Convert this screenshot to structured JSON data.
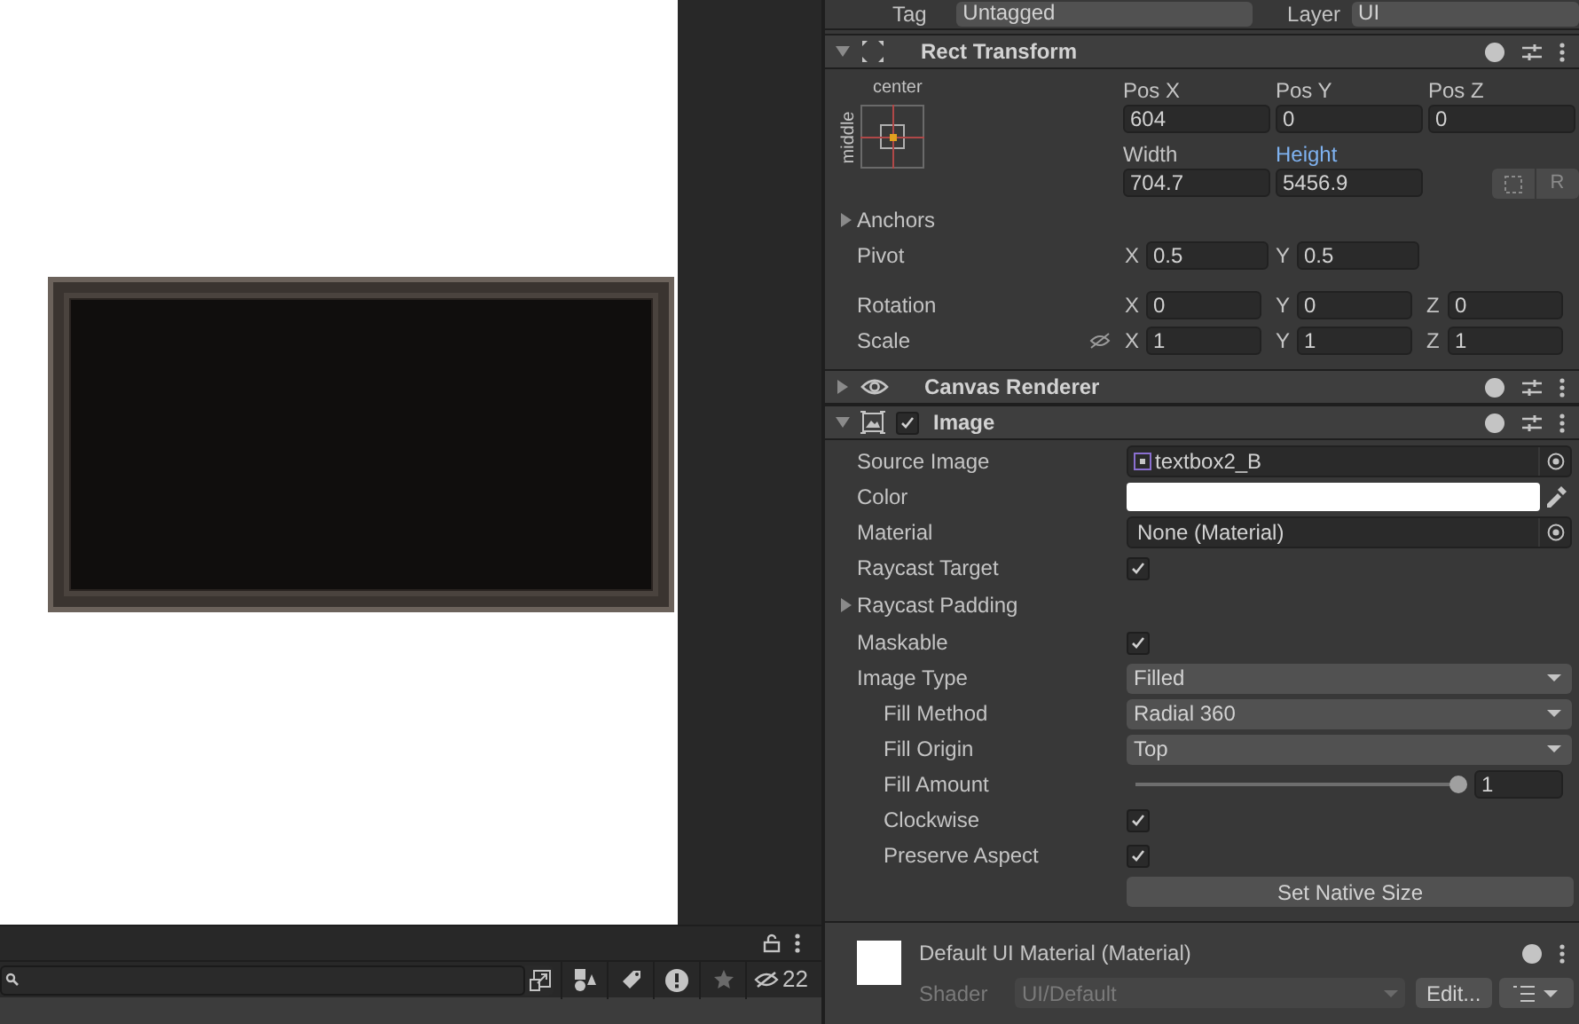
{
  "header_row": {
    "tag_label": "Tag",
    "tag_value": "Untagged",
    "layer_label": "Layer",
    "layer_value": "UI"
  },
  "rect_transform": {
    "title": "Rect Transform",
    "expanded": true,
    "anchor_h": "center",
    "anchor_v": "middle",
    "fields": [
      {
        "label": "Pos X",
        "value": "604",
        "highlighted": false
      },
      {
        "label": "Pos Y",
        "value": "0",
        "highlighted": false
      },
      {
        "label": "Pos Z",
        "value": "0",
        "highlighted": false
      },
      {
        "label": "Width",
        "value": "704.7",
        "highlighted": false
      },
      {
        "label": "Height",
        "value": "5456.9",
        "highlighted": true
      }
    ],
    "raw_button": "R",
    "anchors": {
      "label": "Anchors",
      "expanded": false
    },
    "vectors": [
      {
        "label": "Pivot",
        "axes": [
          {
            "axis": "X",
            "value": "0.5"
          },
          {
            "axis": "Y",
            "value": "0.5"
          }
        ]
      },
      {
        "label": "Rotation",
        "axes": [
          {
            "axis": "X",
            "value": "0"
          },
          {
            "axis": "Y",
            "value": "0"
          },
          {
            "axis": "Z",
            "value": "0"
          }
        ]
      },
      {
        "label": "Scale",
        "constrained": true,
        "axes": [
          {
            "axis": "X",
            "value": "1"
          },
          {
            "axis": "Y",
            "value": "1"
          },
          {
            "axis": "Z",
            "value": "1"
          }
        ]
      }
    ]
  },
  "components": [
    {
      "kind": "canvas_renderer",
      "title": "Canvas Renderer",
      "expanded": false
    },
    {
      "kind": "image",
      "title": "Image",
      "expanded": true,
      "enabled": true
    }
  ],
  "image_properties": [
    {
      "kind": "object",
      "label": "Source Image",
      "value": "textbox2_B",
      "asset": true
    },
    {
      "kind": "color",
      "label": "Color",
      "color": "#ffffff"
    },
    {
      "kind": "object",
      "label": "Material",
      "value": "None (Material)"
    },
    {
      "kind": "checkbox",
      "label": "Raycast Target",
      "checked": true
    },
    {
      "kind": "foldout",
      "label": "Raycast Padding",
      "expanded": false
    },
    {
      "kind": "checkbox",
      "label": "Maskable",
      "checked": true
    },
    {
      "kind": "dropdown",
      "label": "Image Type",
      "value": "Filled",
      "children": [
        {
          "kind": "dropdown",
          "label": "Fill Method",
          "value": "Radial 360"
        },
        {
          "kind": "dropdown",
          "label": "Fill Origin",
          "value": "Top"
        },
        {
          "kind": "slider",
          "label": "Fill Amount",
          "level": 1,
          "value": "1"
        },
        {
          "kind": "checkbox",
          "label": "Clockwise",
          "checked": true
        },
        {
          "kind": "checkbox",
          "label": "Preserve Aspect",
          "checked": true
        },
        {
          "kind": "button",
          "label": "Set Native Size"
        }
      ]
    }
  ],
  "material": {
    "title": "Default UI Material (Material)",
    "shader_label": "Shader",
    "shader_value": "UI/Default",
    "edit_button": "Edit..."
  },
  "bottom_panel": {
    "hidden_count": "22"
  }
}
